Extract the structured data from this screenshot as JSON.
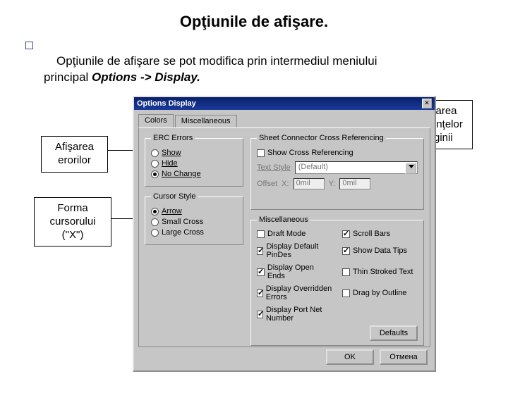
{
  "page": {
    "title": "Opţiunile de afişare.",
    "intro_lead": "Opţiunile de afişare se pot modifica prin intermediul meniului",
    "intro_rest": "principal ",
    "intro_menu": "Options -> Display."
  },
  "callouts": {
    "errors": "Afişarea erorilor",
    "cursor_l1": "Forma",
    "cursor_l2": "cursorului",
    "cursor_l3": "(\"X\")",
    "ref": "Afişarea referinţelor paginii"
  },
  "dialog": {
    "title": "Options Display",
    "tabs": {
      "colors": "Colors",
      "misc": "Miscellaneous"
    },
    "erc": {
      "legend": "ERC Errors",
      "show": "Show",
      "hide": "Hide",
      "nochange": "No Change"
    },
    "cursor": {
      "legend": "Cursor Style",
      "arrow": "Arrow",
      "small": "Small Cross",
      "large": "Large Cross"
    },
    "xref": {
      "legend": "Sheet Connector Cross Referencing",
      "opt": "Show Cross Referencing",
      "textstyle_lbl": "Text Style",
      "textstyle_val": "(Default)",
      "offset_lbl": "Offset",
      "x_lbl": "X:",
      "x_val": "0mil",
      "y_lbl": "Y:",
      "y_val": "0mil"
    },
    "misc": {
      "legend": "Miscellaneous",
      "draft": "Draft Mode",
      "scrollbars": "Scroll Bars",
      "def_pindes": "Display Default PinDes",
      "datatips": "Show Data Tips",
      "open_ends": "Display Open Ends",
      "thin_stroked": "Thin Stroked Text",
      "overridden": "Display Overridden Errors",
      "drag_outline": "Drag by Outline",
      "port_net": "Display Port Net Number"
    },
    "defaults_btn": "Defaults",
    "ok": "OK",
    "cancel": "Отмена"
  }
}
